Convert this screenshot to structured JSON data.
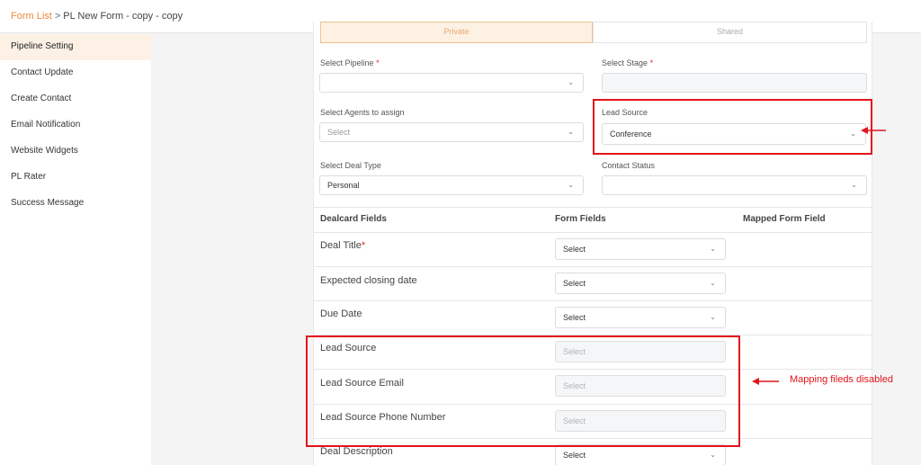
{
  "breadcrumb": {
    "link": "Form List",
    "separator": ">",
    "current": "PL New Form - copy - copy"
  },
  "sidebar": {
    "items": [
      {
        "label": "Pipeline Setting",
        "active": true
      },
      {
        "label": "Contact Update"
      },
      {
        "label": "Create Contact"
      },
      {
        "label": "Email Notification"
      },
      {
        "label": "Website Widgets"
      },
      {
        "label": "PL Rater"
      },
      {
        "label": "Success Message"
      }
    ]
  },
  "visibility": {
    "private": "Private",
    "shared": "Shared"
  },
  "form": {
    "pipeline_label": "Select Pipeline",
    "stage_label": "Select Stage",
    "required_mark": "*",
    "agents_label": "Select Agents to assign",
    "agents_placeholder": "Select",
    "lead_source_label": "Lead Source",
    "lead_source_value": "Conference",
    "deal_type_label": "Select Deal Type",
    "deal_type_value": "Personal",
    "contact_status_label": "Contact Status"
  },
  "mapping": {
    "headers": [
      "Dealcard Fields",
      "Form Fields",
      "Mapped Form Field"
    ],
    "rows": [
      {
        "label": "Deal Title",
        "required": true,
        "value": "Select"
      },
      {
        "label": "Expected closing date",
        "value": "Select"
      },
      {
        "label": "Due Date",
        "value": "Select"
      },
      {
        "label": "Lead Source",
        "value": "Select",
        "disabled": true
      },
      {
        "label": "Lead Source Email",
        "value": "Select",
        "disabled": true
      },
      {
        "label": "Lead Source Phone Number",
        "value": "Select",
        "disabled": true
      },
      {
        "label": "Deal Description",
        "value": "Select"
      }
    ]
  },
  "annotation": {
    "note": "Mapping fileds disabled",
    "color": "#e3131b"
  },
  "colors": {
    "accent": "#f08a3c",
    "active_bg": "#fdf1e5",
    "required": "#e02424"
  },
  "icons": {
    "chevron": "chevron-down-icon",
    "arrow": "arrow-left-icon"
  }
}
